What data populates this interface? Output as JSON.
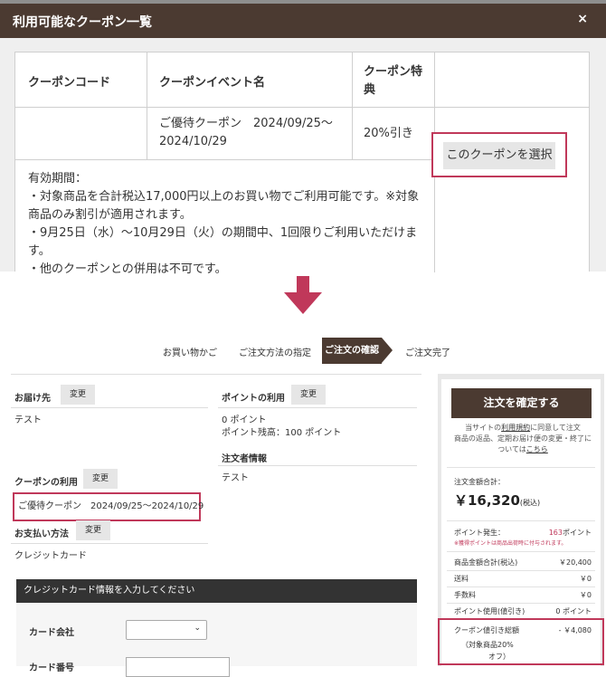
{
  "modal": {
    "title": "利用可能なクーポン一覧",
    "close": "×",
    "headers": {
      "code": "クーポンコード",
      "event": "クーポンイベント名",
      "benefit_1": "クーポン特",
      "benefit_2": "典"
    },
    "row": {
      "event_1": "ご優待クーポン　2024/09/25〜",
      "event_2": "2024/10/29",
      "benefit": "20%引き"
    },
    "validity": [
      "有効期間：",
      "・対象商品を合計税込17,000円以上のお買い物でご利用可能です。※対象",
      "商品のみ割引が適用されます。",
      "・9月25日（水）〜10月29日（火）の期間中、1回限りご利用いただけま",
      "す。",
      "・他のクーポンとの併用は不可です。"
    ],
    "select_button": "このクーポンを選択"
  },
  "steps": {
    "cart": "お買い物かご",
    "method": "ご注文方法の指定",
    "confirm": "ご注文の確認",
    "done": "ご注文完了"
  },
  "order": {
    "delivery_label": "お届け先",
    "change": "変更",
    "delivery_value": "テスト",
    "points_label": "ポイントの利用",
    "points_value": "0 ポイント",
    "points_balance": "ポイント残高：100 ポイント",
    "orderer_label": "注文者情報",
    "orderer_value": "テスト",
    "coupon_label": "クーポンの利用",
    "coupon_value": "ご優待クーポン　2024/09/25〜2024/10/29",
    "payment_label": "お支払い方法",
    "payment_value": "クレジットカード",
    "cc_header": "クレジットカード情報を入力してください",
    "card_company": "カード会社",
    "card_number_partial": "カード番号"
  },
  "summary": {
    "confirm_button": "注文を確定する",
    "terms_pre": "当サイトの",
    "terms_link": "利用規約",
    "terms_post": "に同意して注文",
    "terms_2": "商品の返品、定期お届け便の変更・終了に",
    "terms_3_pre": "ついては",
    "terms_3_link": "こちら",
    "total_label": "注文金額合計：",
    "total": "￥16,320",
    "total_tax": "(税込)",
    "points_gain_label": "ポイント発生：",
    "points_gain": "163",
    "points_unit": "ポイント",
    "points_note": "※獲得ポイントは商品出荷時に付与されます。",
    "rows": [
      {
        "label": "商品金額合計(税込)",
        "value": "￥20,400"
      },
      {
        "label": "送料",
        "value": "￥0"
      },
      {
        "label": "手数料",
        "value": "￥0"
      },
      {
        "label": "ポイント使用(値引き)",
        "value": "0 ポイント"
      }
    ],
    "coupon_discount_label": "クーポン値引き総額",
    "coupon_discount": "- ￥4,080",
    "coupon_note_1": "（対象商品20%",
    "coupon_note_2": "オフ）"
  },
  "colors": {
    "brown": "#4b3a31",
    "accent": "#c0385a",
    "gray_btn": "#e6e6e6"
  }
}
